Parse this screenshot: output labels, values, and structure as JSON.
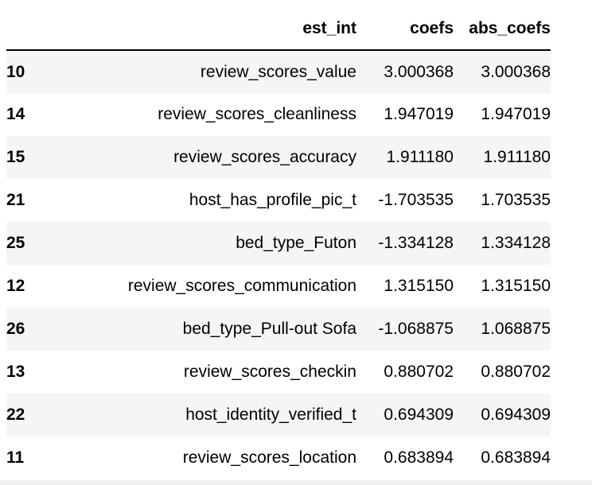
{
  "table": {
    "columns": {
      "index": "",
      "name": "est_int",
      "coefs": "coefs",
      "abs_coefs": "abs_coefs"
    },
    "rows": [
      {
        "index": "10",
        "name": "review_scores_value",
        "coefs": "3.000368",
        "abs_coefs": "3.000368"
      },
      {
        "index": "14",
        "name": "review_scores_cleanliness",
        "coefs": "1.947019",
        "abs_coefs": "1.947019"
      },
      {
        "index": "15",
        "name": "review_scores_accuracy",
        "coefs": "1.911180",
        "abs_coefs": "1.911180"
      },
      {
        "index": "21",
        "name": "host_has_profile_pic_t",
        "coefs": "-1.703535",
        "abs_coefs": "1.703535"
      },
      {
        "index": "25",
        "name": "bed_type_Futon",
        "coefs": "-1.334128",
        "abs_coefs": "1.334128"
      },
      {
        "index": "12",
        "name": "review_scores_communication",
        "coefs": "1.315150",
        "abs_coefs": "1.315150"
      },
      {
        "index": "26",
        "name": "bed_type_Pull-out Sofa",
        "coefs": "-1.068875",
        "abs_coefs": "1.068875"
      },
      {
        "index": "13",
        "name": "review_scores_checkin",
        "coefs": "0.880702",
        "abs_coefs": "0.880702"
      },
      {
        "index": "22",
        "name": "host_identity_verified_t",
        "coefs": "0.694309",
        "abs_coefs": "0.694309"
      },
      {
        "index": "11",
        "name": "review_scores_location",
        "coefs": "0.683894",
        "abs_coefs": "0.683894"
      }
    ]
  }
}
